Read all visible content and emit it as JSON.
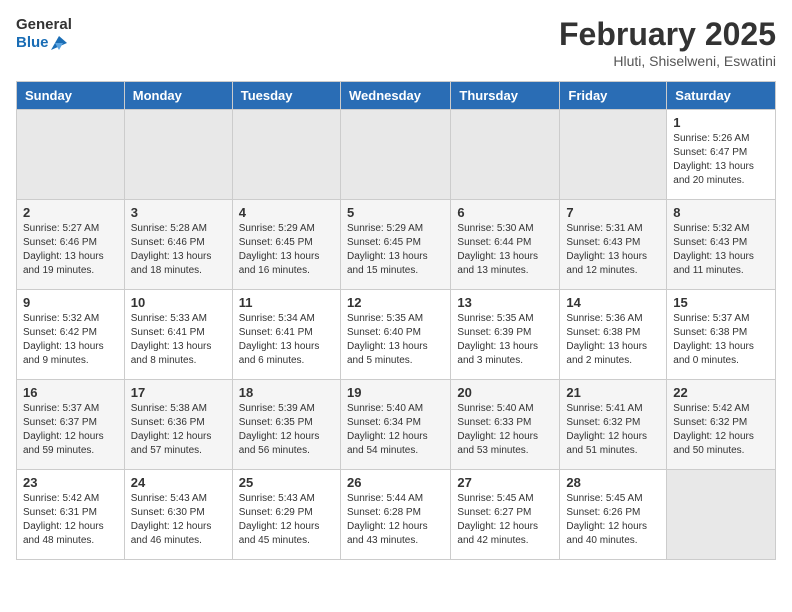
{
  "logo": {
    "general": "General",
    "blue": "Blue"
  },
  "title": "February 2025",
  "location": "Hluti, Shiselweni, Eswatini",
  "days_of_week": [
    "Sunday",
    "Monday",
    "Tuesday",
    "Wednesday",
    "Thursday",
    "Friday",
    "Saturday"
  ],
  "weeks": [
    [
      {
        "num": "",
        "info": ""
      },
      {
        "num": "",
        "info": ""
      },
      {
        "num": "",
        "info": ""
      },
      {
        "num": "",
        "info": ""
      },
      {
        "num": "",
        "info": ""
      },
      {
        "num": "",
        "info": ""
      },
      {
        "num": "1",
        "info": "Sunrise: 5:26 AM\nSunset: 6:47 PM\nDaylight: 13 hours and 20 minutes."
      }
    ],
    [
      {
        "num": "2",
        "info": "Sunrise: 5:27 AM\nSunset: 6:46 PM\nDaylight: 13 hours and 19 minutes."
      },
      {
        "num": "3",
        "info": "Sunrise: 5:28 AM\nSunset: 6:46 PM\nDaylight: 13 hours and 18 minutes."
      },
      {
        "num": "4",
        "info": "Sunrise: 5:29 AM\nSunset: 6:45 PM\nDaylight: 13 hours and 16 minutes."
      },
      {
        "num": "5",
        "info": "Sunrise: 5:29 AM\nSunset: 6:45 PM\nDaylight: 13 hours and 15 minutes."
      },
      {
        "num": "6",
        "info": "Sunrise: 5:30 AM\nSunset: 6:44 PM\nDaylight: 13 hours and 13 minutes."
      },
      {
        "num": "7",
        "info": "Sunrise: 5:31 AM\nSunset: 6:43 PM\nDaylight: 13 hours and 12 minutes."
      },
      {
        "num": "8",
        "info": "Sunrise: 5:32 AM\nSunset: 6:43 PM\nDaylight: 13 hours and 11 minutes."
      }
    ],
    [
      {
        "num": "9",
        "info": "Sunrise: 5:32 AM\nSunset: 6:42 PM\nDaylight: 13 hours and 9 minutes."
      },
      {
        "num": "10",
        "info": "Sunrise: 5:33 AM\nSunset: 6:41 PM\nDaylight: 13 hours and 8 minutes."
      },
      {
        "num": "11",
        "info": "Sunrise: 5:34 AM\nSunset: 6:41 PM\nDaylight: 13 hours and 6 minutes."
      },
      {
        "num": "12",
        "info": "Sunrise: 5:35 AM\nSunset: 6:40 PM\nDaylight: 13 hours and 5 minutes."
      },
      {
        "num": "13",
        "info": "Sunrise: 5:35 AM\nSunset: 6:39 PM\nDaylight: 13 hours and 3 minutes."
      },
      {
        "num": "14",
        "info": "Sunrise: 5:36 AM\nSunset: 6:38 PM\nDaylight: 13 hours and 2 minutes."
      },
      {
        "num": "15",
        "info": "Sunrise: 5:37 AM\nSunset: 6:38 PM\nDaylight: 13 hours and 0 minutes."
      }
    ],
    [
      {
        "num": "16",
        "info": "Sunrise: 5:37 AM\nSunset: 6:37 PM\nDaylight: 12 hours and 59 minutes."
      },
      {
        "num": "17",
        "info": "Sunrise: 5:38 AM\nSunset: 6:36 PM\nDaylight: 12 hours and 57 minutes."
      },
      {
        "num": "18",
        "info": "Sunrise: 5:39 AM\nSunset: 6:35 PM\nDaylight: 12 hours and 56 minutes."
      },
      {
        "num": "19",
        "info": "Sunrise: 5:40 AM\nSunset: 6:34 PM\nDaylight: 12 hours and 54 minutes."
      },
      {
        "num": "20",
        "info": "Sunrise: 5:40 AM\nSunset: 6:33 PM\nDaylight: 12 hours and 53 minutes."
      },
      {
        "num": "21",
        "info": "Sunrise: 5:41 AM\nSunset: 6:32 PM\nDaylight: 12 hours and 51 minutes."
      },
      {
        "num": "22",
        "info": "Sunrise: 5:42 AM\nSunset: 6:32 PM\nDaylight: 12 hours and 50 minutes."
      }
    ],
    [
      {
        "num": "23",
        "info": "Sunrise: 5:42 AM\nSunset: 6:31 PM\nDaylight: 12 hours and 48 minutes."
      },
      {
        "num": "24",
        "info": "Sunrise: 5:43 AM\nSunset: 6:30 PM\nDaylight: 12 hours and 46 minutes."
      },
      {
        "num": "25",
        "info": "Sunrise: 5:43 AM\nSunset: 6:29 PM\nDaylight: 12 hours and 45 minutes."
      },
      {
        "num": "26",
        "info": "Sunrise: 5:44 AM\nSunset: 6:28 PM\nDaylight: 12 hours and 43 minutes."
      },
      {
        "num": "27",
        "info": "Sunrise: 5:45 AM\nSunset: 6:27 PM\nDaylight: 12 hours and 42 minutes."
      },
      {
        "num": "28",
        "info": "Sunrise: 5:45 AM\nSunset: 6:26 PM\nDaylight: 12 hours and 40 minutes."
      },
      {
        "num": "",
        "info": ""
      }
    ]
  ]
}
